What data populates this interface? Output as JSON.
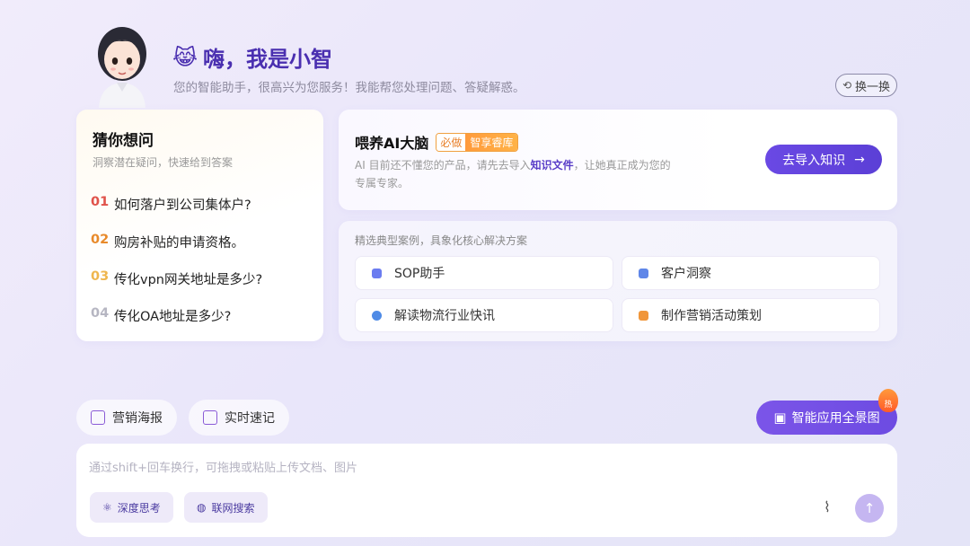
{
  "greeting": {
    "emoji": "😹",
    "title": "嗨，我是小智",
    "subtitle": "您的智能助手，很高兴为您服务！我能帮您处理问题、答疑解惑。",
    "swap_label": "换一换"
  },
  "guess": {
    "title": "猜你想问",
    "subtitle": "洞察潜在疑问，快速给到答案",
    "questions": [
      {
        "num": "01",
        "text": "如何落户到公司集体户?"
      },
      {
        "num": "02",
        "text": "购房补贴的申请资格。"
      },
      {
        "num": "03",
        "text": "传化vpn网关地址是多少?"
      },
      {
        "num": "04",
        "text": "传化OA地址是多少?"
      }
    ]
  },
  "feed": {
    "title": "喂养AI大脑",
    "badge_must": "必做",
    "badge_name": "智享睿库",
    "desc_before": "AI 目前还不懂您的产品，请先去导入",
    "desc_link": "知识文件",
    "desc_after": "，让她真正成为您的专属专家。",
    "import_label": "去导入知识",
    "import_arrow": "→"
  },
  "cases": {
    "title": "精选典型案例，具象化核心解决方案",
    "items": [
      {
        "label": "SOP助手",
        "color": "#6b7cf0"
      },
      {
        "label": "客户洞察",
        "color": "#5f86e8"
      },
      {
        "label": "解读物流行业快讯",
        "color": "#4f8be6"
      },
      {
        "label": "制作营销活动策划",
        "color": "#f0963a"
      }
    ]
  },
  "chips": {
    "poster": "营销海报",
    "notes": "实时速记",
    "panorama": "智能应用全景图",
    "hot": "热"
  },
  "input": {
    "placeholder": "通过shift+回车换行，可拖拽或粘贴上传文档、图片",
    "deep_think": "深度思考",
    "web_search": "联网搜索"
  },
  "icons": {
    "swap": "swap-icon",
    "send": "send-icon",
    "attach": "paperclip-icon"
  },
  "colors": {
    "accent": "#5b3fd6",
    "title": "#4a2fb0"
  }
}
